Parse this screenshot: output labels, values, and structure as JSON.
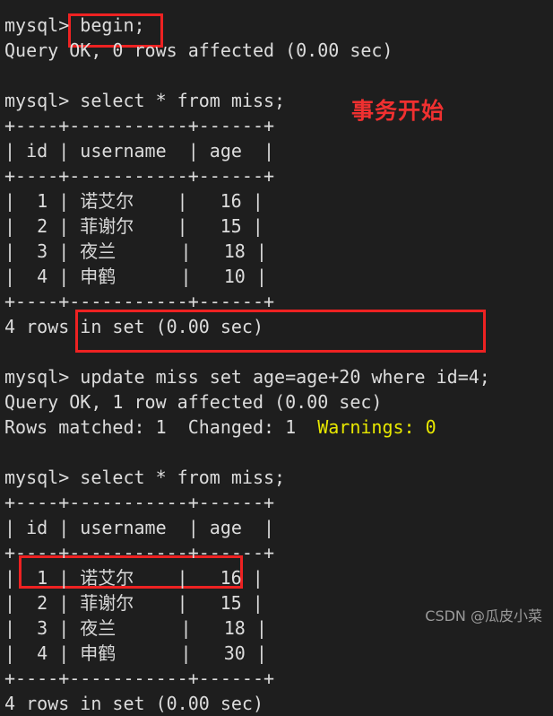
{
  "terminal": {
    "background_color": "#1e1e1e",
    "foreground_color": "#dcdcdc",
    "prompt": "mysql> ",
    "lines": [
      {
        "id": "l01",
        "text": "mysql> begin;"
      },
      {
        "id": "l02",
        "text": "Query OK, 0 rows affected (0.00 sec)"
      },
      {
        "id": "l03",
        "text": ""
      },
      {
        "id": "l04",
        "text": "mysql> select * from miss;"
      },
      {
        "id": "l05",
        "text": "+----+-----------+------+"
      },
      {
        "id": "l06",
        "text": "| id | username  | age  |"
      },
      {
        "id": "l07",
        "text": "+----+-----------+------+"
      },
      {
        "id": "l08",
        "text": "|  1 | 诺艾尔    |   16 |",
        "cjk": true
      },
      {
        "id": "l09",
        "text": "|  2 | 菲谢尔    |   15 |",
        "cjk": true
      },
      {
        "id": "l10",
        "text": "|  3 | 夜兰      |   18 |",
        "cjk": true
      },
      {
        "id": "l11",
        "text": "|  4 | 申鹤      |   10 |",
        "cjk": true
      },
      {
        "id": "l12",
        "text": "+----+-----------+------+"
      },
      {
        "id": "l13",
        "text": "4 rows in set (0.00 sec)"
      },
      {
        "id": "l14",
        "text": ""
      },
      {
        "id": "l15",
        "text": "mysql> update miss set age=age+20 where id=4;"
      },
      {
        "id": "l16",
        "text": "Query OK, 1 row affected (0.00 sec)"
      },
      {
        "id": "l17",
        "text": "Rows matched: 1  Changed: 1  Warnings: 0",
        "warn_from": 29
      },
      {
        "id": "l18",
        "text": ""
      },
      {
        "id": "l19",
        "text": "mysql> select * from miss;"
      },
      {
        "id": "l20",
        "text": "+----+-----------+------+"
      },
      {
        "id": "l21",
        "text": "| id | username  | age  |"
      },
      {
        "id": "l22",
        "text": "+----+-----------+------+"
      },
      {
        "id": "l23",
        "text": "|  1 | 诺艾尔    |   16 |",
        "cjk": true
      },
      {
        "id": "l24",
        "text": "|  2 | 菲谢尔    |   15 |",
        "cjk": true
      },
      {
        "id": "l25",
        "text": "|  3 | 夜兰      |   18 |",
        "cjk": true
      },
      {
        "id": "l26",
        "text": "|  4 | 申鹤      |   30 |",
        "cjk": true
      },
      {
        "id": "l27",
        "text": "+----+-----------+------+"
      },
      {
        "id": "l28",
        "text": "4 rows in set (0.00 sec)"
      }
    ]
  },
  "sql_statements": {
    "begin": "begin;",
    "select_first": "select * from miss;",
    "update": "update miss set age=age+20 where id=4;",
    "select_second": "select * from miss;"
  },
  "results": {
    "begin_result": "Query OK, 0 rows affected (0.00 sec)",
    "update_result": "Query OK, 1 row affected (0.00 sec)",
    "update_detail_prefix": "Rows matched: 1  Changed: 1  ",
    "update_warnings": "Warnings: 0",
    "warnings_color": "#e8e800",
    "row_count_first": "4 rows in set (0.00 sec)",
    "row_count_second": "4 rows in set (0.00 sec)"
  },
  "table_before": {
    "separator": "+----+-----------+------+",
    "columns": [
      "id",
      "username",
      "age"
    ],
    "rows": [
      {
        "id": "1",
        "username": "诺艾尔",
        "age": "16"
      },
      {
        "id": "2",
        "username": "菲谢尔",
        "age": "15"
      },
      {
        "id": "3",
        "username": "夜兰",
        "age": "18"
      },
      {
        "id": "4",
        "username": "申鹤",
        "age": "10"
      }
    ]
  },
  "table_after": {
    "separator": "+----+-----------+------+",
    "columns": [
      "id",
      "username",
      "age"
    ],
    "rows": [
      {
        "id": "1",
        "username": "诺艾尔",
        "age": "16"
      },
      {
        "id": "2",
        "username": "菲谢尔",
        "age": "15"
      },
      {
        "id": "3",
        "username": "夜兰",
        "age": "18"
      },
      {
        "id": "4",
        "username": "申鹤",
        "age": "30"
      }
    ]
  },
  "annotations": {
    "color": "#f03030",
    "transaction_start": "事务开始",
    "boxes": [
      {
        "name": "begin-statement",
        "target": "begin;"
      },
      {
        "name": "update-statement",
        "target": "update miss set age=age+20 where id=4;"
      },
      {
        "name": "updated-row",
        "target": "|  4 | 申鹤      |   30 |"
      }
    ]
  },
  "watermark": {
    "text": "CSDN @瓜皮小菜",
    "color": "#9a9a9a"
  }
}
